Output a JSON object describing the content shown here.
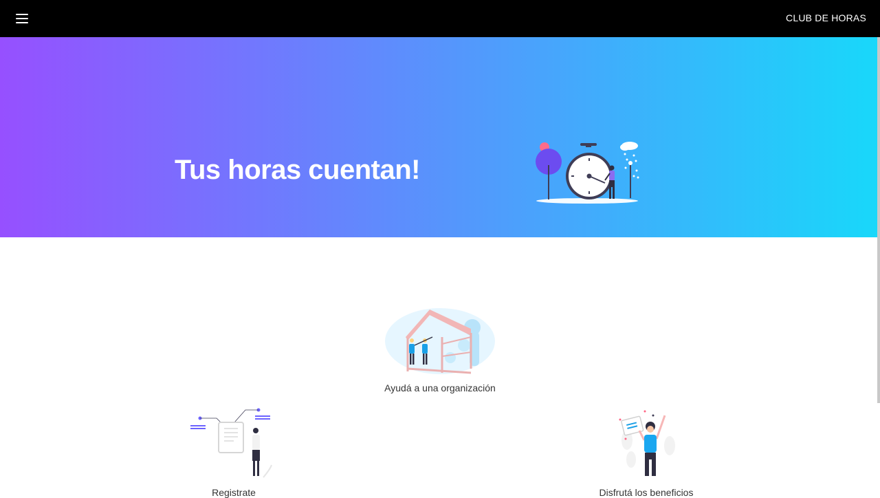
{
  "topbar": {
    "menu_icon": "hamburger-menu-icon",
    "brand": "CLUB DE HORAS"
  },
  "hero": {
    "title": "Tus horas cuentan!",
    "gradient_start": "#9650ff",
    "gradient_end": "#18d8fa",
    "illustration_icon": "stopwatch-illustration"
  },
  "steps": [
    {
      "label": "Ayudá a una organización",
      "illustration_icon": "volunteers-building-illustration"
    },
    {
      "label": "Registrate",
      "illustration_icon": "registration-form-illustration"
    },
    {
      "label": "Disfrutá los beneficios",
      "illustration_icon": "celebration-illustration"
    }
  ]
}
